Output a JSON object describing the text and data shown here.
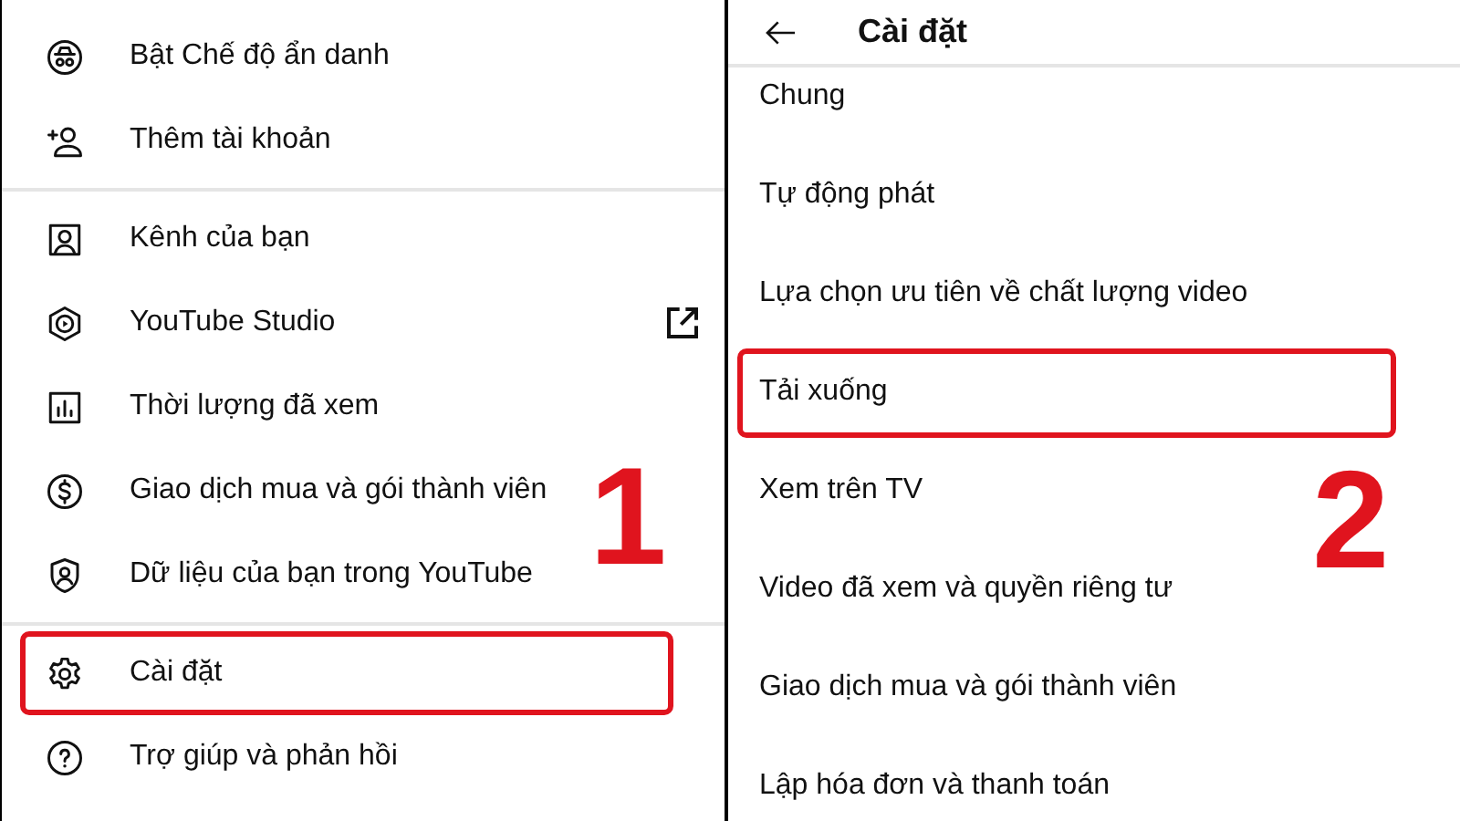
{
  "account_menu": {
    "step": "1",
    "groups": [
      [
        {
          "label": "Bật Chế độ ẩn danh",
          "highlighted": false,
          "external_link": false
        },
        {
          "label": "Thêm tài khoản",
          "highlighted": false,
          "external_link": false
        }
      ],
      [
        {
          "label": "Kênh của bạn",
          "highlighted": false,
          "external_link": false
        },
        {
          "label": "YouTube Studio",
          "highlighted": false,
          "external_link": true
        },
        {
          "label": "Thời lượng đã xem",
          "highlighted": false,
          "external_link": false
        },
        {
          "label": "Giao dịch mua và gói thành viên",
          "highlighted": false,
          "external_link": false
        },
        {
          "label": "Dữ liệu của bạn trong YouTube",
          "highlighted": false,
          "external_link": false
        }
      ],
      [
        {
          "label": "Cài đặt",
          "highlighted": true,
          "external_link": false
        },
        {
          "label": "Trợ giúp và phản hồi",
          "highlighted": false,
          "external_link": false
        }
      ]
    ]
  },
  "settings": {
    "title": "Cài đặt",
    "step": "2",
    "items": [
      {
        "label": "Chung",
        "highlighted": false
      },
      {
        "label": "Tự động phát",
        "highlighted": false
      },
      {
        "label": "Lựa chọn ưu tiên về chất lượng video",
        "highlighted": false
      },
      {
        "label": "Tải xuống",
        "highlighted": true
      },
      {
        "label": "Xem trên TV",
        "highlighted": false
      },
      {
        "label": "Video đã xem và quyền riêng tư",
        "highlighted": false
      },
      {
        "label": "Giao dịch mua và gói thành viên",
        "highlighted": false
      },
      {
        "label": "Lập hóa đơn và thanh toán",
        "highlighted": false
      }
    ]
  }
}
